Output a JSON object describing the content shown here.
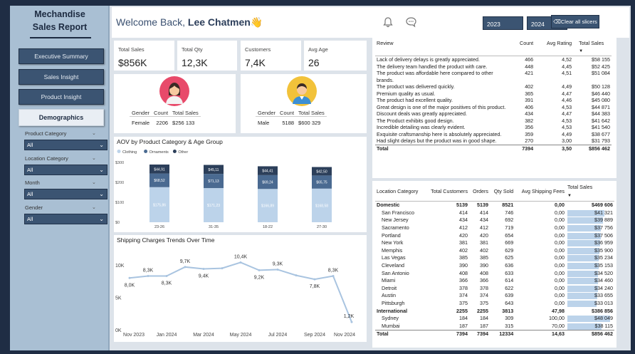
{
  "brand": {
    "line1": "Mechandise",
    "line2": "Sales Report"
  },
  "nav": [
    {
      "label": "Executive Summary",
      "active": false
    },
    {
      "label": "Sales Insight",
      "active": false
    },
    {
      "label": "Product Insight",
      "active": false
    },
    {
      "label": "Demographics",
      "active": true
    }
  ],
  "filters": [
    {
      "label": "Product Category",
      "value": "All"
    },
    {
      "label": "Location Category",
      "value": "All"
    },
    {
      "label": "Month",
      "value": "All"
    },
    {
      "label": "Gender",
      "value": "All"
    }
  ],
  "header": {
    "welcome_prefix": "Welcome Back,",
    "user_name": "Lee Chatmen👋",
    "bell_icon": "bell-icon",
    "chat_icon": "chat-icon",
    "year_buttons": [
      "2023",
      "2024"
    ],
    "clear_label": "Clear all slicers",
    "clear_icon": "eraser-icon"
  },
  "kpis": [
    {
      "title": "Total Sales",
      "value": "$856K"
    },
    {
      "title": "Total Qty",
      "value": "12,3K"
    },
    {
      "title": "Customers",
      "value": "7,4K"
    },
    {
      "title": "Avg Age",
      "value": "26"
    }
  ],
  "gender_cards": {
    "headers": [
      "Gender",
      "Count",
      "Total Sales"
    ],
    "female": {
      "gender": "Female",
      "count": "2206",
      "sales": "$256 133"
    },
    "male": {
      "gender": "Male",
      "count": "5188",
      "sales": "$600 329"
    }
  },
  "chart_data": [
    {
      "type": "bar",
      "stacked": true,
      "title": "AOV by Product Category & Age Group",
      "categories": [
        "23-26",
        "31-35",
        "18-22",
        "27-30"
      ],
      "series": [
        {
          "name": "Clothing",
          "color": "#bcd3ea",
          "values": [
            175.86,
            171.23,
            166.89,
            168.58
          ],
          "labels": [
            "$175,86",
            "$171,23",
            "$166,89",
            "$168,58"
          ]
        },
        {
          "name": "Ornaments",
          "color": "#4a6a91",
          "values": [
            68.52,
            71.13,
            69.24,
            65.75
          ],
          "labels": [
            "$68,52",
            "$71,13",
            "$69,24",
            "$65,75"
          ]
        },
        {
          "name": "Other",
          "color": "#2c3f5a",
          "values": [
            44.91,
            45.11,
            44.41,
            42.5
          ],
          "labels": [
            "$44,91",
            "$45,11",
            "$44,41",
            "$42,50"
          ]
        }
      ],
      "yticks": [
        "$0",
        "$100",
        "$200",
        "$300"
      ],
      "ylim": [
        0,
        300
      ],
      "legend": "top-left"
    },
    {
      "type": "line",
      "title": "Shipping Charges Trends Over Time",
      "x": [
        "Nov 2023",
        "Dec 2023",
        "Jan 2024",
        "Feb 2024",
        "Mar 2024",
        "Apr 2024",
        "May 2024",
        "Jun 2024",
        "Jul 2024",
        "Aug 2024",
        "Sep 2024",
        "Oct 2024",
        "Nov 2024"
      ],
      "xtick_labels": [
        "Nov 2023",
        "Jan 2024",
        "Mar 2024",
        "May 2024",
        "Jul 2024",
        "Sep 2024",
        "Nov 2024"
      ],
      "values": [
        8.0,
        8.3,
        8.3,
        9.7,
        9.4,
        9.5,
        10.4,
        9.2,
        9.3,
        8.4,
        7.8,
        8.3,
        1.2
      ],
      "point_labels": [
        "8,0K",
        "8,3K",
        "8,3K",
        "9,7K",
        "9,4K",
        "",
        "10,4K",
        "9,2K",
        "9,3K",
        "",
        "7,8K",
        "8,3K",
        "1,2K"
      ],
      "yticks": [
        "0K",
        "5K",
        "10K"
      ],
      "ylim": [
        0,
        11
      ],
      "color": "#a9c4e0"
    }
  ],
  "reviews": {
    "headers": [
      "Review",
      "Count",
      "Avg Rating",
      "Total Sales"
    ],
    "rows": [
      {
        "text": "Lack of delivery delays is greatly appreciated.",
        "count": "466",
        "rating": "4,52",
        "sales": "$58 155"
      },
      {
        "text": "The delivery team handled the product with care.",
        "count": "448",
        "rating": "4,45",
        "sales": "$52 425"
      },
      {
        "text": "The product was affordable here compared to other brands.",
        "count": "421",
        "rating": "4,51",
        "sales": "$51 084"
      },
      {
        "text": "The product was delivered quickly.",
        "count": "402",
        "rating": "4,49",
        "sales": "$50 128"
      },
      {
        "text": "Premium quality as usual.",
        "count": "365",
        "rating": "4,47",
        "sales": "$46 440"
      },
      {
        "text": "The product had excellent quality.",
        "count": "391",
        "rating": "4,46",
        "sales": "$45 080"
      },
      {
        "text": "Great design is one of the major positives of this product.",
        "count": "406",
        "rating": "4,53",
        "sales": "$44 871"
      },
      {
        "text": "Discount deals was greatly appreciated.",
        "count": "434",
        "rating": "4,47",
        "sales": "$44 383"
      },
      {
        "text": "The Product exhibits good design.",
        "count": "382",
        "rating": "4,53",
        "sales": "$41 642"
      },
      {
        "text": "Incredible detailing was clearly evident.",
        "count": "356",
        "rating": "4,53",
        "sales": "$41 540"
      },
      {
        "text": "Exquisite craftsmanship here is absolutely appreciated.",
        "count": "359",
        "rating": "4,49",
        "sales": "$38 677"
      },
      {
        "text": "Had slight delays but the product was in good shape.",
        "count": "270",
        "rating": "3,00",
        "sales": "$31 793"
      }
    ],
    "total": {
      "label": "Total",
      "count": "7394",
      "rating": "3,50",
      "sales": "$856 462"
    }
  },
  "locations": {
    "headers": [
      "Location Category",
      "Total Customers",
      "Orders",
      "Qty Sold",
      "Avg Shipping Fees",
      "Total Sales"
    ],
    "rows": [
      {
        "name": "Domestic",
        "group": true,
        "customers": "5139",
        "orders": "5139",
        "qty": "8521",
        "fees": "0,00",
        "sales": "$469 606",
        "v": 0
      },
      {
        "name": "San Francisco",
        "customers": "414",
        "orders": "414",
        "qty": "746",
        "fees": "0,00",
        "sales": "$41 321",
        "v": 41321
      },
      {
        "name": "New Jersey",
        "customers": "434",
        "orders": "434",
        "qty": "692",
        "fees": "0,00",
        "sales": "$39 889",
        "v": 39889
      },
      {
        "name": "Sacramento",
        "customers": "412",
        "orders": "412",
        "qty": "719",
        "fees": "0,00",
        "sales": "$37 756",
        "v": 37756
      },
      {
        "name": "Portland",
        "customers": "420",
        "orders": "420",
        "qty": "654",
        "fees": "0,00",
        "sales": "$37 506",
        "v": 37506
      },
      {
        "name": "New York",
        "customers": "381",
        "orders": "381",
        "qty": "669",
        "fees": "0,00",
        "sales": "$36 959",
        "v": 36959
      },
      {
        "name": "Memphis",
        "customers": "402",
        "orders": "402",
        "qty": "629",
        "fees": "0,00",
        "sales": "$35 900",
        "v": 35900
      },
      {
        "name": "Las Vegas",
        "customers": "385",
        "orders": "385",
        "qty": "625",
        "fees": "0,00",
        "sales": "$35 234",
        "v": 35234
      },
      {
        "name": "Cleveland",
        "customers": "390",
        "orders": "390",
        "qty": "636",
        "fees": "0,00",
        "sales": "$35 153",
        "v": 35153
      },
      {
        "name": "San Antonio",
        "customers": "408",
        "orders": "408",
        "qty": "633",
        "fees": "0,00",
        "sales": "$34 520",
        "v": 34520
      },
      {
        "name": "Miami",
        "customers": "366",
        "orders": "366",
        "qty": "614",
        "fees": "0,00",
        "sales": "$34 460",
        "v": 34460
      },
      {
        "name": "Detroit",
        "customers": "378",
        "orders": "378",
        "qty": "622",
        "fees": "0,00",
        "sales": "$34 240",
        "v": 34240
      },
      {
        "name": "Austin",
        "customers": "374",
        "orders": "374",
        "qty": "639",
        "fees": "0,00",
        "sales": "$33 655",
        "v": 33655
      },
      {
        "name": "Pittsburgh",
        "customers": "375",
        "orders": "375",
        "qty": "643",
        "fees": "0,00",
        "sales": "$33 013",
        "v": 33013
      },
      {
        "name": "International",
        "group": true,
        "customers": "2255",
        "orders": "2255",
        "qty": "3813",
        "fees": "47,98",
        "sales": "$386 856",
        "v": 0
      },
      {
        "name": "Sydney",
        "customers": "184",
        "orders": "184",
        "qty": "309",
        "fees": "100,00",
        "sales": "$48 049",
        "v": 48049
      },
      {
        "name": "Mumbai",
        "customers": "187",
        "orders": "187",
        "qty": "315",
        "fees": "70,00",
        "sales": "$38 115",
        "v": 38115
      }
    ],
    "total": {
      "name": "Total",
      "customers": "7394",
      "orders": "7394",
      "qty": "12334",
      "fees": "14,63",
      "sales": "$856 462"
    }
  }
}
